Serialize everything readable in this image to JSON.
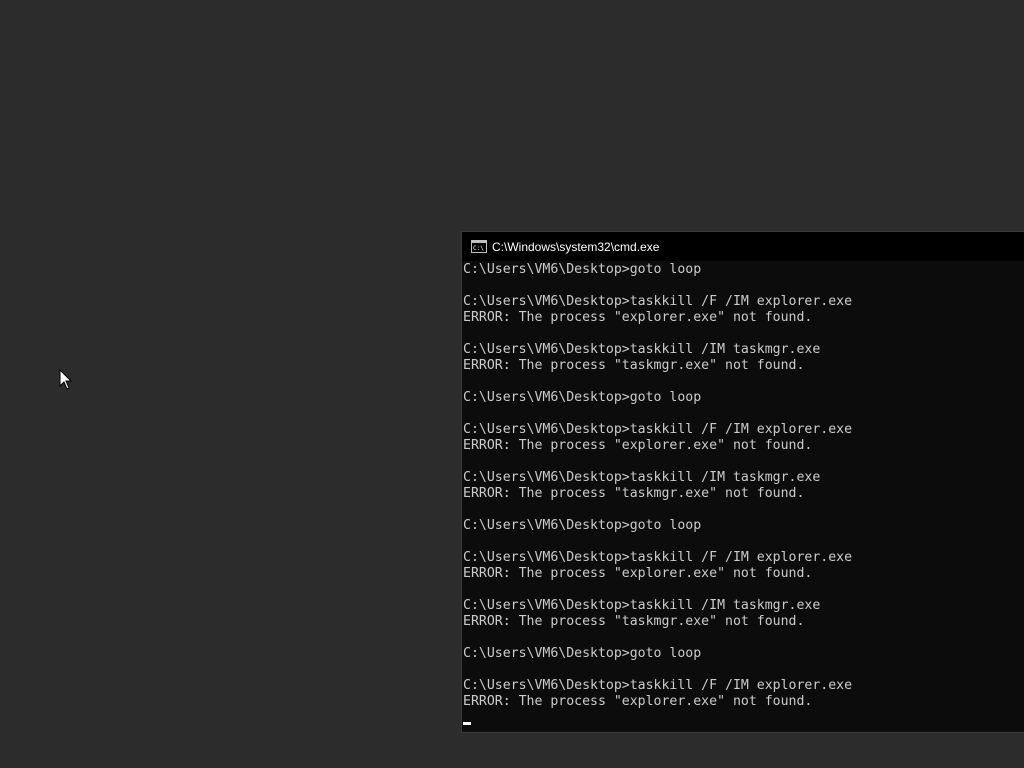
{
  "window": {
    "title": "C:\\Windows\\system32\\cmd.exe",
    "icon": "cmd-console-icon"
  },
  "console": {
    "lines": [
      "C:\\Users\\VM6\\Desktop>goto loop",
      "",
      "C:\\Users\\VM6\\Desktop>taskkill /F /IM explorer.exe",
      "ERROR: The process \"explorer.exe\" not found.",
      "",
      "C:\\Users\\VM6\\Desktop>taskkill /IM taskmgr.exe",
      "ERROR: The process \"taskmgr.exe\" not found.",
      "",
      "C:\\Users\\VM6\\Desktop>goto loop",
      "",
      "C:\\Users\\VM6\\Desktop>taskkill /F /IM explorer.exe",
      "ERROR: The process \"explorer.exe\" not found.",
      "",
      "C:\\Users\\VM6\\Desktop>taskkill /IM taskmgr.exe",
      "ERROR: The process \"taskmgr.exe\" not found.",
      "",
      "C:\\Users\\VM6\\Desktop>goto loop",
      "",
      "C:\\Users\\VM6\\Desktop>taskkill /F /IM explorer.exe",
      "ERROR: The process \"explorer.exe\" not found.",
      "",
      "C:\\Users\\VM6\\Desktop>taskkill /IM taskmgr.exe",
      "ERROR: The process \"taskmgr.exe\" not found.",
      "",
      "C:\\Users\\VM6\\Desktop>goto loop",
      "",
      "C:\\Users\\VM6\\Desktop>taskkill /F /IM explorer.exe",
      "ERROR: The process \"explorer.exe\" not found.",
      ""
    ]
  },
  "colors": {
    "desktop_bg": "#2c2c2c",
    "console_bg": "#0c0c0c",
    "console_text": "#cccccc",
    "titlebar_bg": "#000000"
  }
}
